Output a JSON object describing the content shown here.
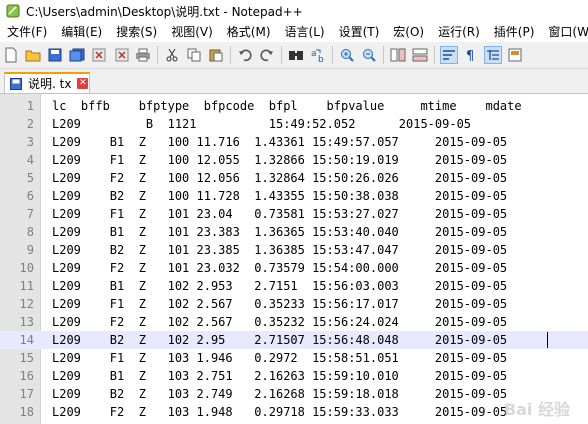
{
  "window": {
    "title": "C:\\Users\\admin\\Desktop\\说明.txt - Notepad++"
  },
  "menu": [
    "文件(F)",
    "编辑(E)",
    "搜索(S)",
    "视图(V)",
    "格式(M)",
    "语言(L)",
    "设置(T)",
    "宏(O)",
    "运行(R)",
    "插件(P)",
    "窗口(W)"
  ],
  "toolbar": {
    "icons": [
      "new-file-icon",
      "open-file-icon",
      "save-icon",
      "save-all-icon",
      "close-icon",
      "close-all-icon",
      "print-icon",
      "cut-icon",
      "copy-icon",
      "paste-icon",
      "undo-icon",
      "redo-icon",
      "find-icon",
      "replace-icon",
      "zoom-in-icon",
      "zoom-out-icon",
      "sync-v-icon",
      "sync-h-icon",
      "word-wrap-icon",
      "show-all-chars-icon",
      "indent-guide-icon",
      "doc-map-icon"
    ]
  },
  "tab": {
    "label": "说明. tx",
    "close": "✕"
  },
  "editor": {
    "current_line": 14,
    "lines": [
      "lc  bffb    bfptype  bfpcode  bfpl    bfpvalue     mtime    mdate",
      "L209         B  1121          15:49:52.052      2015-09-05",
      "L209    B1  Z   100 11.716  1.43361 15:49:57.057     2015-09-05",
      "L209    F1  Z   100 12.055  1.32866 15:50:19.019     2015-09-05",
      "L209    F2  Z   100 12.056  1.32864 15:50:26.026     2015-09-05",
      "L209    B2  Z   100 11.728  1.43355 15:50:38.038     2015-09-05",
      "L209    F1  Z   101 23.04   0.73581 15:53:27.027     2015-09-05",
      "L209    B1  Z   101 23.383  1.36365 15:53:40.040     2015-09-05",
      "L209    B2  Z   101 23.385  1.36385 15:53:47.047     2015-09-05",
      "L209    F2  Z   101 23.032  0.73579 15:54:00.000     2015-09-05",
      "L209    B1  Z   102 2.953   2.7151  15:56:03.003     2015-09-05",
      "L209    F1  Z   102 2.567   0.35233 15:56:17.017     2015-09-05",
      "L209    F2  Z   102 2.567   0.35232 15:56:24.024     2015-09-05",
      "L209    B2  Z   102 2.95    2.71507 15:56:48.048     2015-09-05",
      "L209    F1  Z   103 1.946   0.2972  15:58:51.051     2015-09-05",
      "L209    B1  Z   103 2.751   2.16263 15:59:10.010     2015-09-05",
      "L209    B2  Z   103 2.749   2.16268 15:59:18.018     2015-09-05",
      "L209    F2  Z   103 1.948   0.29718 15:59:33.033     2015-09-05"
    ]
  },
  "watermark": "Bai 经验"
}
